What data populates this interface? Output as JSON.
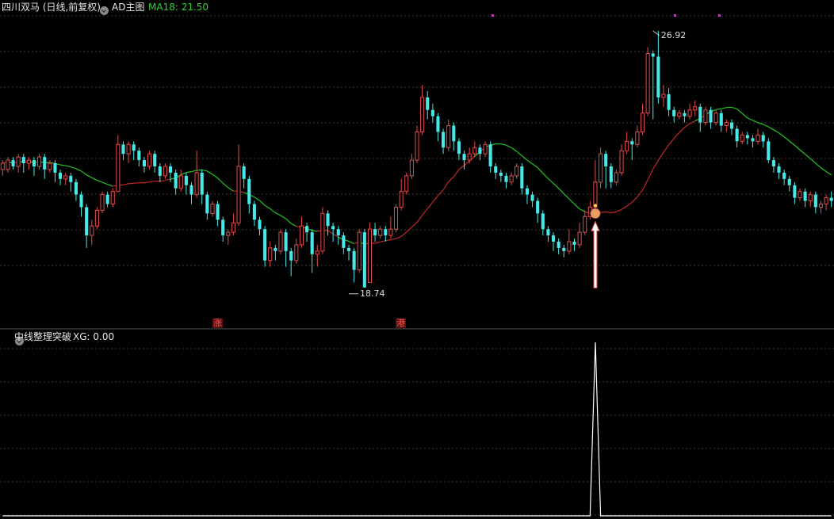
{
  "header": {
    "title": "四川双马 (日线,前复权)",
    "indicator": "AD主图",
    "ma_label": "MA18: 21.50"
  },
  "sub_panel": {
    "indicator": "中线整理突破",
    "xg_label": "XG: 0.00"
  },
  "markers": {
    "zhang": "涨",
    "gang": "港"
  },
  "colors": {
    "up": "#e24b4b",
    "down": "#47e8e8",
    "ma": "#22c522",
    "ma_below": "#c42828",
    "signal": "#ffffff",
    "grid": "#3a3a3a"
  },
  "chart_data": {
    "type": "candlestick",
    "title": "四川双马 (日线,前复权)",
    "ylim": [
      17.8,
      27.4
    ],
    "annotations": [
      {
        "text": "26.92",
        "value": 26.92,
        "bar": 124,
        "position": "high"
      },
      {
        "text": "18.74",
        "value": 18.74,
        "bar": 66,
        "position": "low"
      }
    ],
    "ma_series": {
      "name": "MA18",
      "last": 21.5
    },
    "candles": [
      [
        22.5,
        22.7,
        22.3,
        22.8
      ],
      [
        22.5,
        22.8,
        22.4,
        22.9
      ],
      [
        22.8,
        22.6,
        22.5,
        22.9
      ],
      [
        22.6,
        22.9,
        22.4,
        23.0
      ],
      [
        22.9,
        22.7,
        22.4,
        23.0
      ],
      [
        22.7,
        22.8,
        22.5,
        22.9
      ],
      [
        22.8,
        22.6,
        22.3,
        22.9
      ],
      [
        22.6,
        22.9,
        22.5,
        23.0
      ],
      [
        22.9,
        22.5,
        22.2,
        23.0
      ],
      [
        22.5,
        22.7,
        22.4,
        22.8
      ],
      [
        22.7,
        22.4,
        22.1,
        22.8
      ],
      [
        22.4,
        22.2,
        22.0,
        22.5
      ],
      [
        22.2,
        22.3,
        22.0,
        22.4
      ],
      [
        22.3,
        22.1,
        21.8,
        22.4
      ],
      [
        22.1,
        21.7,
        21.5,
        22.2
      ],
      [
        21.7,
        21.3,
        21.0,
        21.8
      ],
      [
        21.3,
        20.4,
        20.0,
        21.4
      ],
      [
        20.4,
        20.7,
        20.1,
        20.9
      ],
      [
        20.7,
        21.2,
        20.6,
        21.3
      ],
      [
        21.2,
        21.7,
        21.1,
        21.8
      ],
      [
        21.7,
        21.4,
        21.3,
        21.8
      ],
      [
        21.4,
        21.8,
        21.3,
        21.9
      ],
      [
        21.8,
        23.3,
        21.8,
        23.6
      ],
      [
        23.3,
        23.0,
        22.8,
        23.4
      ],
      [
        23.0,
        23.3,
        22.7,
        23.4
      ],
      [
        23.3,
        23.1,
        22.8,
        23.4
      ],
      [
        23.1,
        22.8,
        22.6,
        23.2
      ],
      [
        22.8,
        22.6,
        22.4,
        22.9
      ],
      [
        22.6,
        23.0,
        22.5,
        23.1
      ],
      [
        23.0,
        22.6,
        22.4,
        23.1
      ],
      [
        22.6,
        22.3,
        22.1,
        22.7
      ],
      [
        22.3,
        22.6,
        22.2,
        22.7
      ],
      [
        22.6,
        22.4,
        22.1,
        22.7
      ],
      [
        22.4,
        21.9,
        21.7,
        22.5
      ],
      [
        21.9,
        22.3,
        21.8,
        22.5
      ],
      [
        22.3,
        22.0,
        21.7,
        22.4
      ],
      [
        22.0,
        21.7,
        21.4,
        22.1
      ],
      [
        21.7,
        22.4,
        21.6,
        23.1
      ],
      [
        22.4,
        21.7,
        21.4,
        22.5
      ],
      [
        21.7,
        21.1,
        20.9,
        21.8
      ],
      [
        21.1,
        21.4,
        21.0,
        21.5
      ],
      [
        21.4,
        20.9,
        20.7,
        21.5
      ],
      [
        20.9,
        20.4,
        20.2,
        21.0
      ],
      [
        20.4,
        20.5,
        20.1,
        20.6
      ],
      [
        20.5,
        20.8,
        20.4,
        21.1
      ],
      [
        20.8,
        22.6,
        20.7,
        23.3
      ],
      [
        22.6,
        22.2,
        21.9,
        22.7
      ],
      [
        22.2,
        21.4,
        21.1,
        22.3
      ],
      [
        21.4,
        20.9,
        20.7,
        21.5
      ],
      [
        20.9,
        20.6,
        20.4,
        21.0
      ],
      [
        20.6,
        19.6,
        19.4,
        20.7
      ],
      [
        19.6,
        20.0,
        19.4,
        20.2
      ],
      [
        20.0,
        19.9,
        19.6,
        20.1
      ],
      [
        19.9,
        20.5,
        19.8,
        20.6
      ],
      [
        20.5,
        19.9,
        19.4,
        20.6
      ],
      [
        19.9,
        19.6,
        19.1,
        20.0
      ],
      [
        19.6,
        20.1,
        19.5,
        20.3
      ],
      [
        20.1,
        20.7,
        20.0,
        21.0
      ],
      [
        20.7,
        20.5,
        20.2,
        20.8
      ],
      [
        20.5,
        19.8,
        19.2,
        20.6
      ],
      [
        19.8,
        19.9,
        19.4,
        20.1
      ],
      [
        19.9,
        21.1,
        19.8,
        21.3
      ],
      [
        21.1,
        20.7,
        20.4,
        21.2
      ],
      [
        20.7,
        20.6,
        20.2,
        20.8
      ],
      [
        20.6,
        20.4,
        20.1,
        20.7
      ],
      [
        20.4,
        20.0,
        19.8,
        20.5
      ],
      [
        20.0,
        19.9,
        19.6,
        20.1
      ],
      [
        19.9,
        19.3,
        18.9,
        20.0
      ],
      [
        19.3,
        20.5,
        19.2,
        20.6
      ],
      [
        20.5,
        18.74,
        18.74,
        20.6
      ],
      [
        18.9,
        20.6,
        18.9,
        20.8
      ],
      [
        20.6,
        20.4,
        20.2,
        20.8
      ],
      [
        20.4,
        20.6,
        20.3,
        20.7
      ],
      [
        20.6,
        20.4,
        20.2,
        20.7
      ],
      [
        20.4,
        20.6,
        20.3,
        21.0
      ],
      [
        20.6,
        21.3,
        20.5,
        21.4
      ],
      [
        21.3,
        21.8,
        21.2,
        22.2
      ],
      [
        21.8,
        22.3,
        21.7,
        22.4
      ],
      [
        22.3,
        22.8,
        22.2,
        23.0
      ],
      [
        22.8,
        23.7,
        22.7,
        23.9
      ],
      [
        23.7,
        24.8,
        23.6,
        25.2
      ],
      [
        24.8,
        24.4,
        24.1,
        25.0
      ],
      [
        24.4,
        24.2,
        24.0,
        24.6
      ],
      [
        24.2,
        23.7,
        23.4,
        24.3
      ],
      [
        23.7,
        23.2,
        23.0,
        23.8
      ],
      [
        23.2,
        23.9,
        23.1,
        24.1
      ],
      [
        23.9,
        23.4,
        23.1,
        24.0
      ],
      [
        23.4,
        23.0,
        22.8,
        23.5
      ],
      [
        23.0,
        22.8,
        22.5,
        23.1
      ],
      [
        22.8,
        23.0,
        22.7,
        23.2
      ],
      [
        23.0,
        23.2,
        22.9,
        23.4
      ],
      [
        23.2,
        23.0,
        22.8,
        23.3
      ],
      [
        23.0,
        23.3,
        22.9,
        23.4
      ],
      [
        23.3,
        22.6,
        22.4,
        23.4
      ],
      [
        22.6,
        22.4,
        22.2,
        22.7
      ],
      [
        22.4,
        22.3,
        22.1,
        22.5
      ],
      [
        22.3,
        22.1,
        21.9,
        22.4
      ],
      [
        22.1,
        22.3,
        22.0,
        22.4
      ],
      [
        22.3,
        22.6,
        22.2,
        22.7
      ],
      [
        22.6,
        21.9,
        21.7,
        22.7
      ],
      [
        21.9,
        21.7,
        21.4,
        22.0
      ],
      [
        21.7,
        21.5,
        21.3,
        21.8
      ],
      [
        21.5,
        21.1,
        20.8,
        21.6
      ],
      [
        21.1,
        20.6,
        20.4,
        21.2
      ],
      [
        20.6,
        20.4,
        20.2,
        20.7
      ],
      [
        20.4,
        20.2,
        19.9,
        20.5
      ],
      [
        20.2,
        20.0,
        19.8,
        20.3
      ],
      [
        20.0,
        19.9,
        19.7,
        20.1
      ],
      [
        19.9,
        20.2,
        19.8,
        20.6
      ],
      [
        20.2,
        20.1,
        19.9,
        20.3
      ],
      [
        20.1,
        20.5,
        20.0,
        20.8
      ],
      [
        20.5,
        21.0,
        20.4,
        21.2
      ],
      [
        21.0,
        21.3,
        20.9,
        21.5
      ],
      [
        21.3,
        22.1,
        21.2,
        22.8
      ],
      [
        22.1,
        23.0,
        21.9,
        23.2
      ],
      [
        23.0,
        22.6,
        21.9,
        23.1
      ],
      [
        22.6,
        22.1,
        21.9,
        22.7
      ],
      [
        22.1,
        22.4,
        22.0,
        22.5
      ],
      [
        22.4,
        23.1,
        22.3,
        23.3
      ],
      [
        23.1,
        23.4,
        23.0,
        23.7
      ],
      [
        23.4,
        23.3,
        22.8,
        23.5
      ],
      [
        23.3,
        23.7,
        23.2,
        23.9
      ],
      [
        23.7,
        24.3,
        23.6,
        24.6
      ],
      [
        24.3,
        26.2,
        24.2,
        26.4
      ],
      [
        26.2,
        26.1,
        24.1,
        26.3
      ],
      [
        26.1,
        24.8,
        24.6,
        26.92
      ],
      [
        24.8,
        24.9,
        24.5,
        25.2
      ],
      [
        24.9,
        24.4,
        24.2,
        25.1
      ],
      [
        24.4,
        24.2,
        24.0,
        24.5
      ],
      [
        24.2,
        24.3,
        24.1,
        24.4
      ],
      [
        24.3,
        24.2,
        24.0,
        24.4
      ],
      [
        24.2,
        24.4,
        24.1,
        24.6
      ],
      [
        24.4,
        24.5,
        24.2,
        24.7
      ],
      [
        24.5,
        24.0,
        23.7,
        24.6
      ],
      [
        24.0,
        24.4,
        23.9,
        24.5
      ],
      [
        24.4,
        24.0,
        23.8,
        24.5
      ],
      [
        24.0,
        24.3,
        23.9,
        24.4
      ],
      [
        24.3,
        23.9,
        23.7,
        24.4
      ],
      [
        23.9,
        24.0,
        23.7,
        24.1
      ],
      [
        24.0,
        23.8,
        23.6,
        24.1
      ],
      [
        23.8,
        23.4,
        23.2,
        23.9
      ],
      [
        23.4,
        23.6,
        23.3,
        23.7
      ],
      [
        23.6,
        23.5,
        23.3,
        23.7
      ],
      [
        23.5,
        23.4,
        23.2,
        23.6
      ],
      [
        23.4,
        23.6,
        23.3,
        23.8
      ],
      [
        23.6,
        23.4,
        23.2,
        23.7
      ],
      [
        23.4,
        22.8,
        22.7,
        23.5
      ],
      [
        22.8,
        22.6,
        22.4,
        22.9
      ],
      [
        22.6,
        22.4,
        22.2,
        22.7
      ],
      [
        22.4,
        22.2,
        22.0,
        22.5
      ],
      [
        22.2,
        22.0,
        21.8,
        22.3
      ],
      [
        22.0,
        21.6,
        21.4,
        22.1
      ],
      [
        21.6,
        21.8,
        21.5,
        21.9
      ],
      [
        21.8,
        21.5,
        21.3,
        21.9
      ],
      [
        21.5,
        21.7,
        21.3,
        21.8
      ],
      [
        21.7,
        21.3,
        21.1,
        21.8
      ],
      [
        21.3,
        21.4,
        21.1,
        21.5
      ],
      [
        21.4,
        21.6,
        21.2,
        21.7
      ],
      [
        21.6,
        21.5,
        21.3,
        21.8
      ]
    ],
    "signal": {
      "name": "XG",
      "bar": 113,
      "value": 1,
      "latest": 0.0
    }
  }
}
